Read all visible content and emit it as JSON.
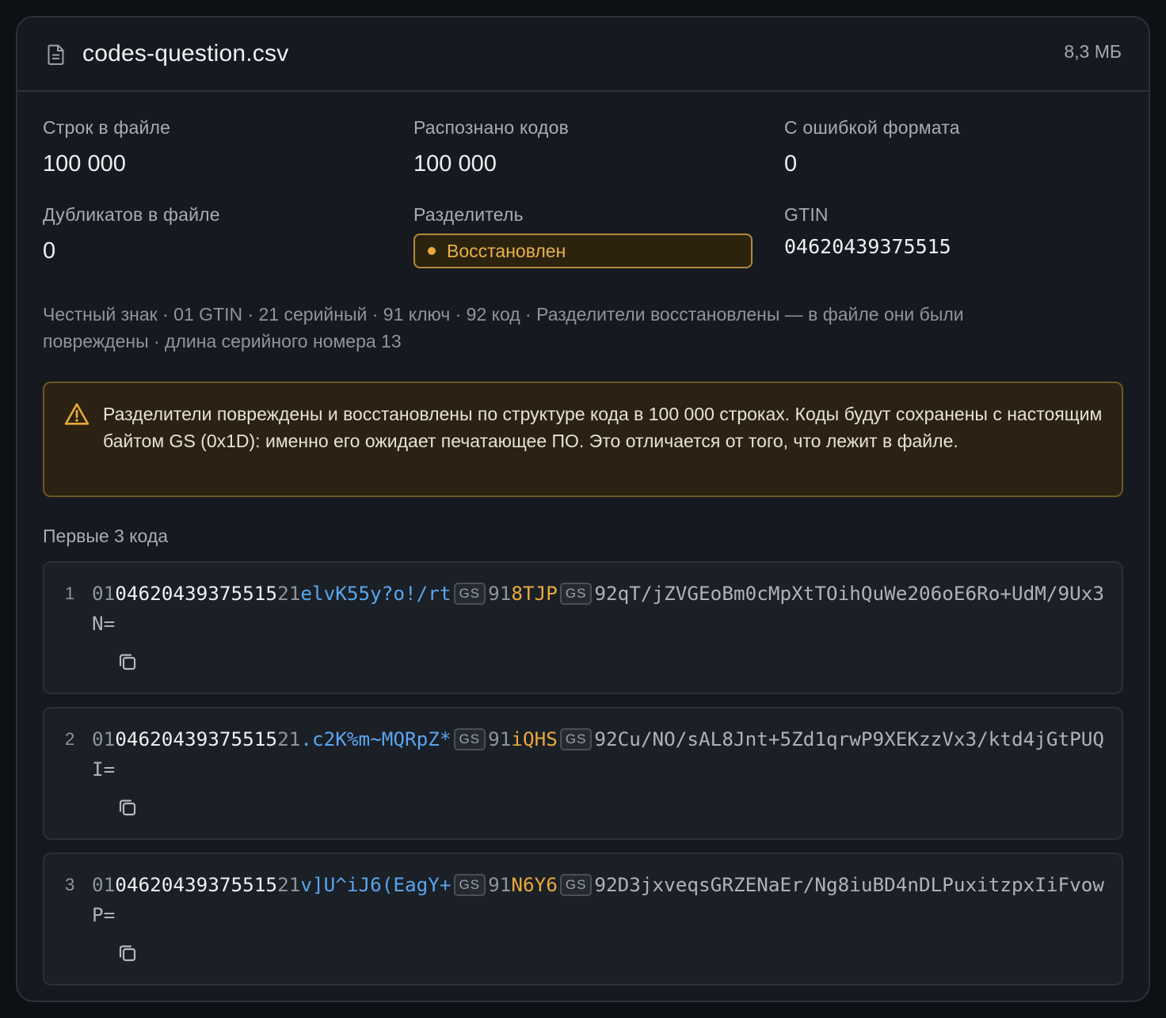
{
  "file": {
    "name": "codes-question.csv",
    "size": "8,3 МБ",
    "icon": "file-icon"
  },
  "stats": {
    "rows": {
      "label": "Строк в файле",
      "value": "100 000"
    },
    "recognized": {
      "label": "Распознано кодов",
      "value": "100 000"
    },
    "format_errors": {
      "label": "С ошибкой формата",
      "value": "0"
    },
    "duplicates": {
      "label": "Дубликатов в файле",
      "value": "0"
    },
    "separator": {
      "label": "Разделитель",
      "value": "Восстановлен"
    },
    "gtin": {
      "label": "GTIN",
      "value": "04620439375515"
    }
  },
  "meta_line": "Честный знак · 01 GTIN · 21 серийный · 91 ключ · 92 код · Разделители восстановлены — в файле они были повреждены · длина серийного номера 13",
  "alert": {
    "icon": "warning-icon",
    "text": "Разделители повреждены и восстановлены по структуре кода в 100 000 строках. Коды будут сохранены с настоящим байтом GS (0x1D): именно его ожидает печатающее ПО. Это отличается от того, что лежит в файле."
  },
  "codes_section": {
    "title": "Первые 3 кода",
    "gs_label": "GS",
    "codes": [
      {
        "num": "1",
        "ai01": "01",
        "gtin": "04620439375515",
        "ai21": "21",
        "serial": "elvK55y?o!/rt",
        "ai91": "91",
        "key": "8TJP",
        "tail": "92qT/jZVGEoBm0cMpXtTOihQuWe206oE6Ro+UdM/9Ux3N="
      },
      {
        "num": "2",
        "ai01": "01",
        "gtin": "04620439375515",
        "ai21": "21",
        "serial": ".c2K%m~MQRpZ*",
        "ai91": "91",
        "key": "iQHS",
        "tail": "92Cu/NO/sAL8Jnt+5Zd1qrwP9XEKzzVx3/ktd4jGtPUQI="
      },
      {
        "num": "3",
        "ai01": "01",
        "gtin": "04620439375515",
        "ai21": "21",
        "serial": "v]U^iJ6(EagY+",
        "ai91": "91",
        "key": "N6Y6",
        "tail": "92D3jxveqsGRZENaEr/Ng8iuBD4nDLPuxitzpxIiFvowP="
      }
    ]
  },
  "colors": {
    "accent_warning": "#e8a93c",
    "serial_blue": "#58a6f0"
  }
}
